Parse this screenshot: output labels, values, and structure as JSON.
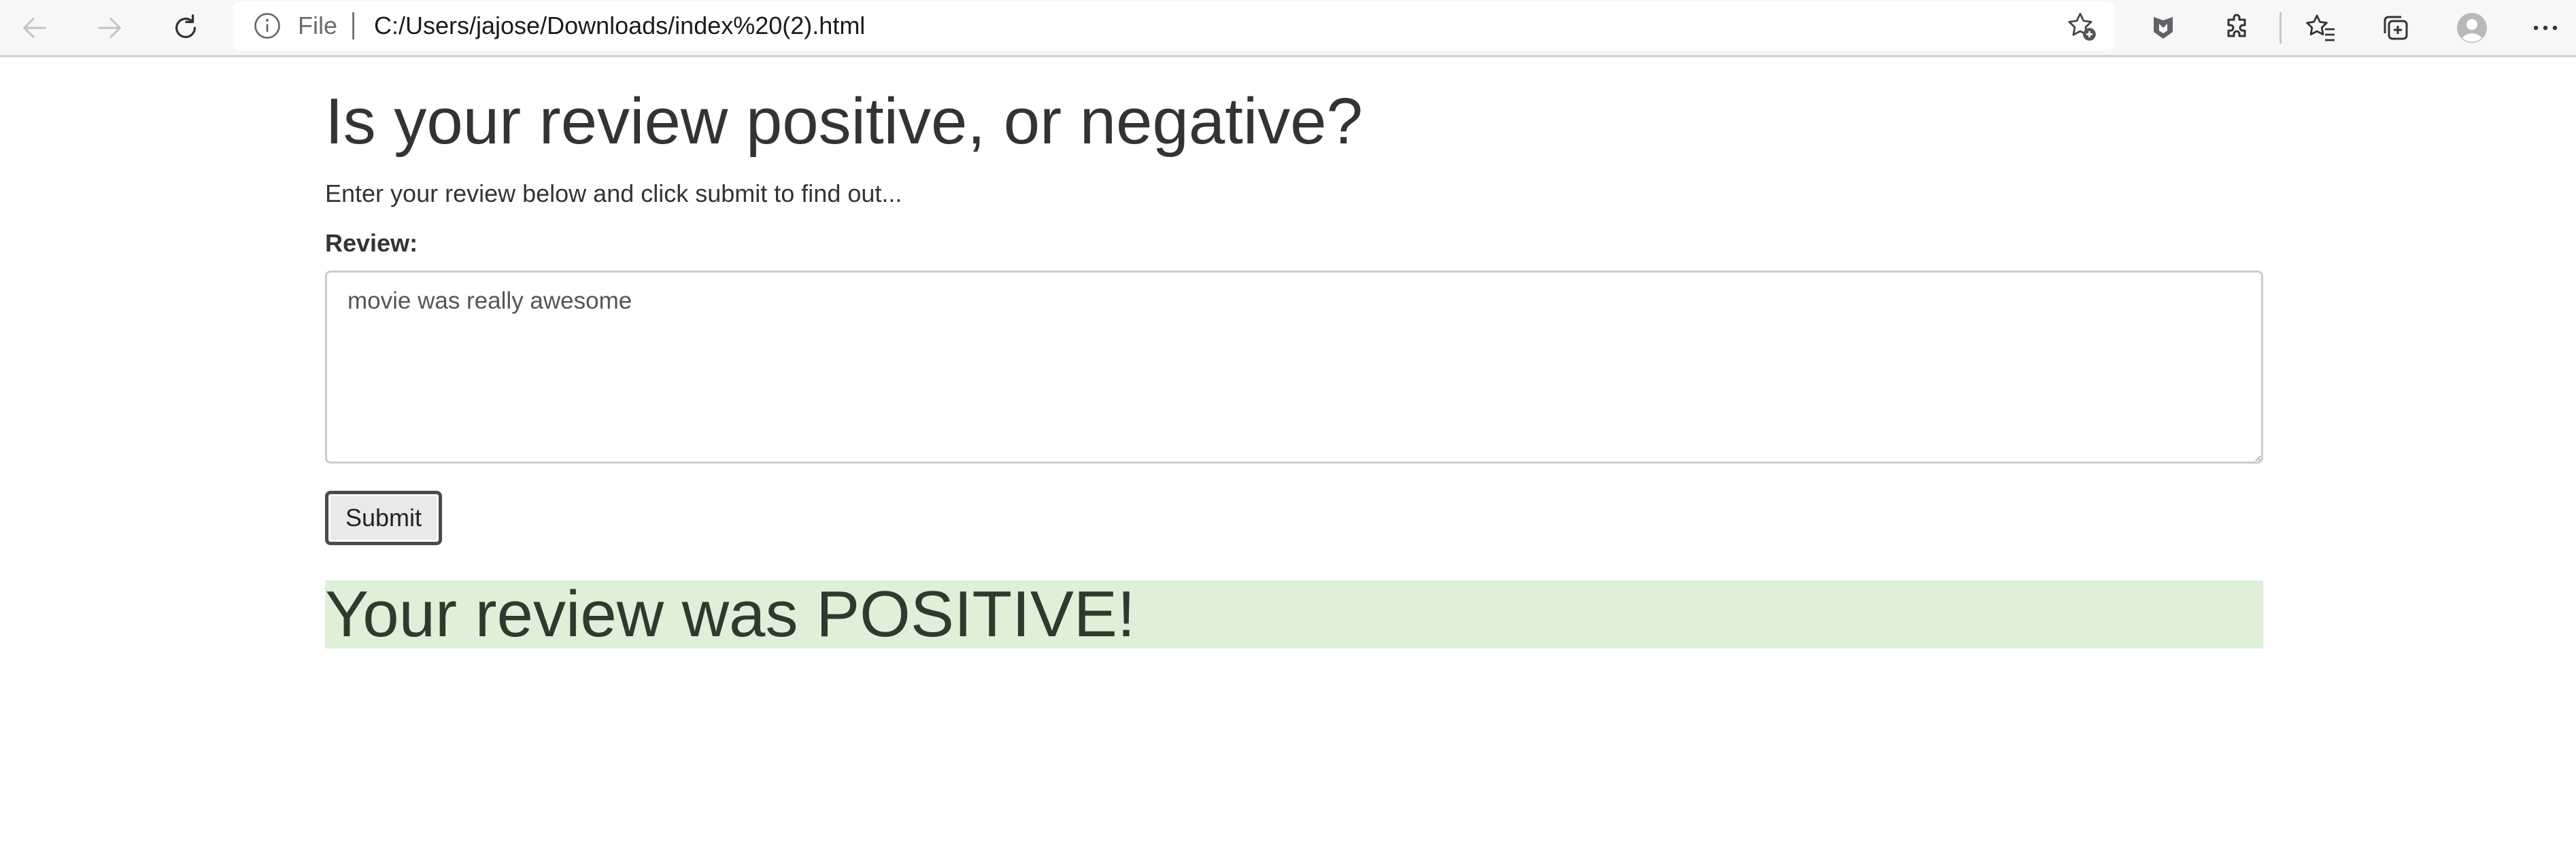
{
  "browser": {
    "scheme_label": "File",
    "url": "C:/Users/jajose/Downloads/index%20(2).html",
    "toolbar_icons": [
      "back-icon",
      "forward-icon",
      "refresh-icon",
      "info-icon",
      "add-favorite-icon",
      "extension-shield-icon",
      "extensions-puzzle-icon",
      "favorites-icon",
      "collections-icon",
      "profile-icon",
      "more-icon"
    ]
  },
  "page": {
    "title": "Is your review positive, or negative?",
    "subtitle": "Enter your review below and click submit to find out...",
    "review_label": "Review:",
    "review_value": "movie was really awesome",
    "submit_label": "Submit",
    "result_text": "Your review was POSITIVE!"
  },
  "colors": {
    "result_background": "#dff0d8",
    "text": "#333333",
    "toolbar_background": "#f7f7f7"
  }
}
